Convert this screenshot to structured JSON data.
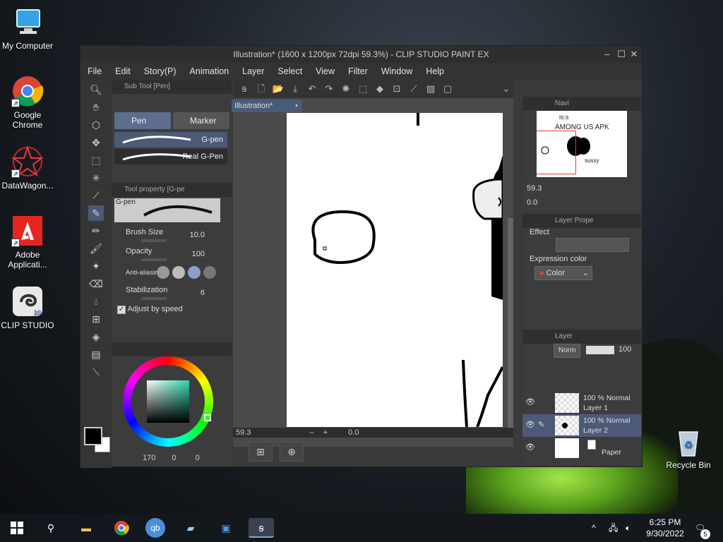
{
  "desktop": {
    "icons": [
      {
        "label": "My Computer"
      },
      {
        "label": "Google Chrome"
      },
      {
        "label": "DataWagon..."
      },
      {
        "label": "Adobe Applicati..."
      },
      {
        "label": "CLIP STUDIO"
      },
      {
        "label": "Recycle Bin"
      }
    ]
  },
  "window": {
    "title": "Illustration* (1600 x 1200px 72dpi 59.3%) - CLIP STUDIO PAINT EX",
    "menu": [
      "File",
      "Edit",
      "Story(P)",
      "Animation",
      "Layer",
      "Select",
      "View",
      "Filter",
      "Window",
      "Help"
    ]
  },
  "subtool": {
    "header": "Sub Tool [Pen]",
    "tabs": [
      "Pen",
      "Marker"
    ],
    "brushes": [
      "G-pen",
      "Real G-Pen"
    ]
  },
  "toolprop": {
    "header": "Tool property [G-pe",
    "preview_label": "G-pen",
    "brush_size_label": "Brush Size",
    "brush_size_value": "10.0",
    "opacity_label": "Opacity",
    "opacity_value": "100",
    "antialias_label": "Anti-aliasin",
    "stabilization_label": "Stabilization",
    "stabilization_value": "6",
    "adjust_label": "Adjust by speed"
  },
  "color": {
    "readout": [
      "170",
      "0",
      "0"
    ],
    "main_color": "#000000",
    "sub_color": "#ffffff",
    "wheel_selected": "#2fd4b0"
  },
  "canvas": {
    "tab_label": "Illustration*",
    "zoom": "59.3",
    "angle": "0.0"
  },
  "navigator": {
    "header": "Navi",
    "zoom": "59.3",
    "angle": "0.0",
    "preview_text": [
      "is:s",
      "AMONG US APK",
      "sussy"
    ]
  },
  "layer_property": {
    "header": "Layer Prope",
    "effect_label": "Effect",
    "expression_label": "Expression color",
    "expression_value": "Color"
  },
  "layers": {
    "header": "Layer",
    "blend_mode": "Norm",
    "opacity": "100",
    "rows": [
      {
        "mode": "100 % Normal",
        "name": "Layer 1"
      },
      {
        "mode": "100 % Normal",
        "name": "Layer 2"
      },
      {
        "mode": "",
        "name": "Paper"
      }
    ]
  },
  "taskbar": {
    "time": "6:25 PM",
    "date": "9/30/2022",
    "notification_count": "5"
  }
}
